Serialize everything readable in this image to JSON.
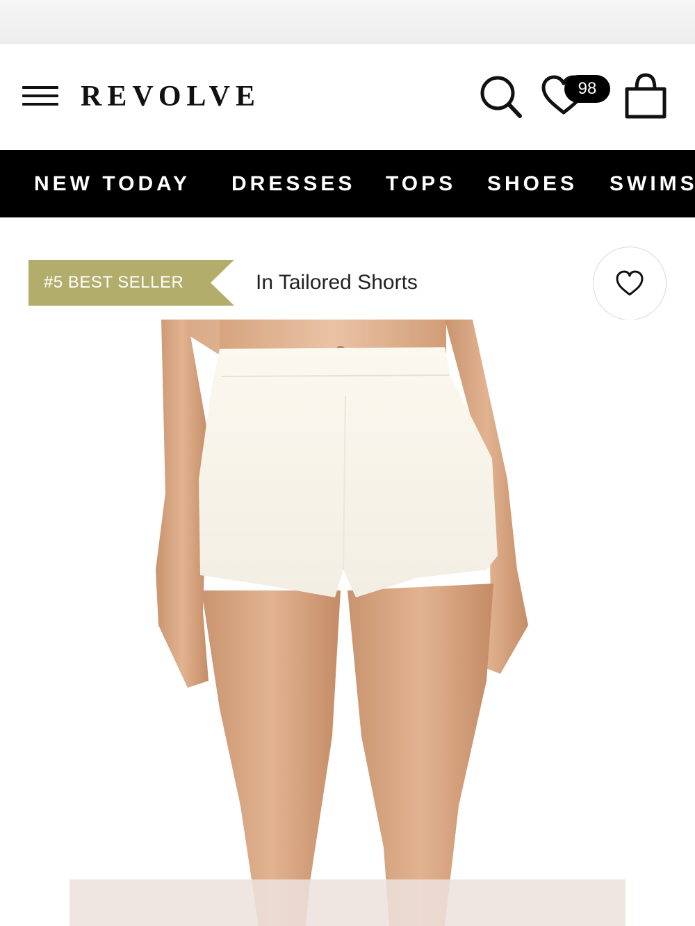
{
  "header": {
    "logo": "REVOLVE",
    "wishlist_count": "98",
    "icons": {
      "menu": "hamburger-menu-icon",
      "search": "search-icon",
      "wishlist": "heart-icon",
      "bag": "shopping-bag-icon"
    }
  },
  "nav": {
    "items": [
      {
        "label": "NEW TODAY"
      },
      {
        "label": "DRESSES"
      },
      {
        "label": "TOPS"
      },
      {
        "label": "SHOES"
      },
      {
        "label": "SWIMS"
      }
    ]
  },
  "product": {
    "badge_rank": "#5 BEST SELLER",
    "badge_category": "In Tailored Shorts",
    "badge_color": "#b3ad6c",
    "favorite_icon": "heart-outline-icon"
  }
}
